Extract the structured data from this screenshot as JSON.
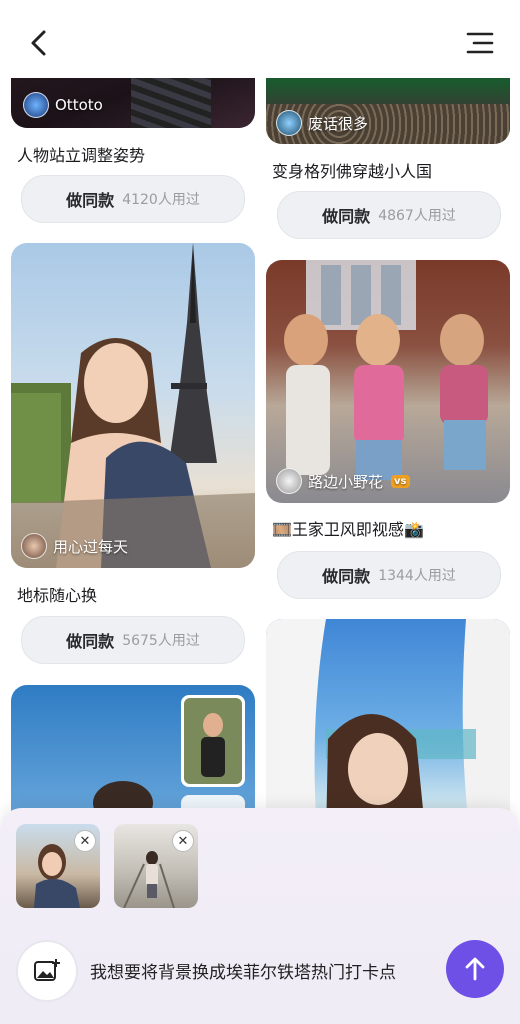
{
  "header": {
    "back_icon": "chevron-left-icon",
    "menu_icon": "menu-icon"
  },
  "feed": {
    "card1": {
      "author": "Ottoto",
      "title": "人物站立调整姿势",
      "action_label": "做同款",
      "used_count": "4120人用过"
    },
    "card2": {
      "author": "废话很多",
      "title": "变身格列佛穿越小人国",
      "action_label": "做同款",
      "used_count": "4867人用过"
    },
    "card3": {
      "author": "用心过每天",
      "title": "地标随心换",
      "action_label": "做同款",
      "used_count": "5675人用过"
    },
    "card4": {
      "author": "路边小野花",
      "badge": "vs",
      "title_prefix_emoji": "🎞️",
      "title": "王家卫风即视感",
      "title_suffix_emoji": "📸",
      "action_label": "做同款",
      "used_count": "1344人用过"
    }
  },
  "composer": {
    "prompt": "我想要将背景换成埃菲尔铁塔热门打卡点",
    "close_symbol": "✕",
    "add_image_icon": "add-image-icon",
    "send_icon": "arrow-up-icon",
    "accent": "#6e50e6"
  }
}
